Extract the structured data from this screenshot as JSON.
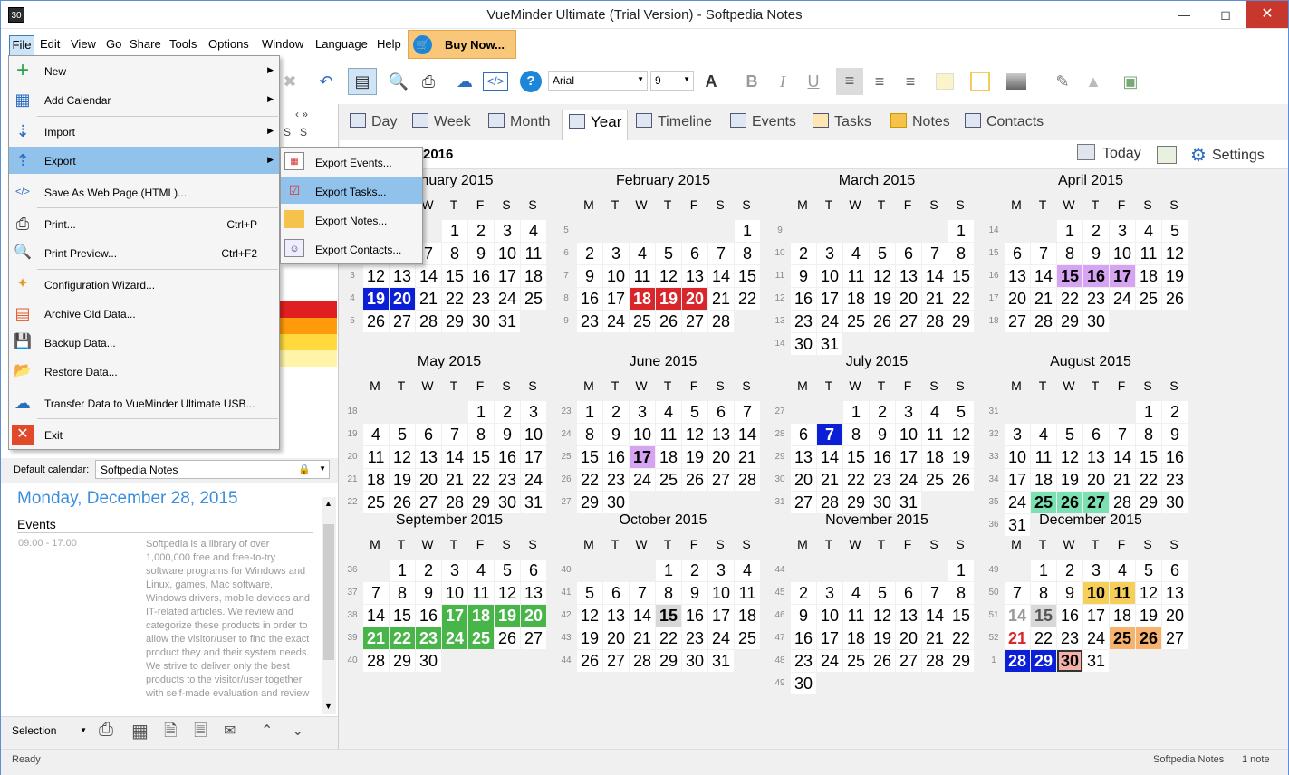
{
  "window": {
    "title": "VueMinder Ultimate (Trial Version) - Softpedia Notes",
    "icon_text": "30"
  },
  "menubar": {
    "items": [
      "File",
      "Edit",
      "View",
      "Go",
      "Share",
      "Tools",
      "Options",
      "Window",
      "Language",
      "Help"
    ],
    "buy_now": "Buy Now..."
  },
  "toolbar": {
    "font": "Arial",
    "size": "9"
  },
  "file_menu": {
    "items": [
      {
        "label": "New",
        "submenu": true
      },
      {
        "label": "Add Calendar",
        "submenu": true
      },
      {
        "label": "Import",
        "submenu": true
      },
      {
        "label": "Export",
        "submenu": true
      },
      {
        "label": "Save As Web Page (HTML)..."
      },
      {
        "label": "Print...",
        "shortcut": "Ctrl+P"
      },
      {
        "label": "Print Preview...",
        "shortcut": "Ctrl+F2"
      },
      {
        "label": "Configuration Wizard..."
      },
      {
        "label": "Archive Old Data..."
      },
      {
        "label": "Backup Data..."
      },
      {
        "label": "Restore Data..."
      },
      {
        "label": "Transfer Data to VueMinder Ultimate USB..."
      },
      {
        "label": "Exit"
      }
    ]
  },
  "export_submenu": {
    "items": [
      "Export Events...",
      "Export Tasks...",
      "Export Notes...",
      "Export Contacts..."
    ]
  },
  "view_tabs": [
    "Day",
    "Week",
    "Month",
    "Year",
    "Timeline",
    "Events",
    "Tasks",
    "Notes",
    "Contacts"
  ],
  "range_label": "2016",
  "today_label": "Today",
  "settings_label": "Settings",
  "default_calendar": {
    "label": "Default calendar:",
    "value": "Softpedia Notes"
  },
  "day_info": {
    "title": "Monday, December 28, 2015",
    "events_label": "Events",
    "event_time": "09:00 - 17:00",
    "event_description": "Softpedia is a library of over 1,000,000 free and free-to-try software programs for Windows and Linux, games, Mac software, Windows drivers, mobile devices and IT-related articles. We review and categorize these products in order to allow the visitor/user to find the exact product they and their system needs. We strive to deliver only the best products to the visitor/user together with self-made evaluation and review"
  },
  "bottom_bar": {
    "selection": "Selection"
  },
  "mini_calendar": {
    "header": [
      "S",
      "S"
    ]
  },
  "weekdays": [
    "M",
    "T",
    "W",
    "T",
    "F",
    "S",
    "S"
  ],
  "months": [
    {
      "name": "January 2015",
      "offset": 3,
      "days": 31,
      "week_start": 1
    },
    {
      "name": "February 2015",
      "offset": 6,
      "days": 28,
      "week_start": 5
    },
    {
      "name": "March 2015",
      "offset": 6,
      "days": 31,
      "week_start": 9
    },
    {
      "name": "April 2015",
      "offset": 2,
      "days": 30,
      "week_start": 14
    },
    {
      "name": "May 2015",
      "offset": 4,
      "days": 31,
      "week_start": 18
    },
    {
      "name": "June 2015",
      "offset": 0,
      "days": 30,
      "week_start": 23
    },
    {
      "name": "July 2015",
      "offset": 2,
      "days": 31,
      "week_start": 27
    },
    {
      "name": "August 2015",
      "offset": 5,
      "days": 31,
      "week_start": 31
    },
    {
      "name": "September 2015",
      "offset": 1,
      "days": 30,
      "week_start": 36
    },
    {
      "name": "October 2015",
      "offset": 3,
      "days": 31,
      "week_start": 40
    },
    {
      "name": "November 2015",
      "offset": 6,
      "days": 30,
      "week_start": 44
    },
    {
      "name": "December 2015",
      "offset": 1,
      "days": 31,
      "week_start": 49
    }
  ],
  "highlights": [
    {
      "m": 0,
      "d": [
        19,
        20
      ],
      "bg": "#0a1fd6",
      "fg": "#ffffff"
    },
    {
      "m": 1,
      "d": [
        18,
        19,
        20
      ],
      "bg": "#d9262b",
      "fg": "#ffffff"
    },
    {
      "m": 3,
      "d": [
        15,
        16,
        17
      ],
      "bg": "#d6a4f2",
      "fg": "#000000"
    },
    {
      "m": 5,
      "d": [
        17
      ],
      "bg": "#d6a4f2",
      "fg": "#000000"
    },
    {
      "m": 6,
      "d": [
        7
      ],
      "bg": "#0a1fd6",
      "fg": "#ffffff"
    },
    {
      "m": 7,
      "d": [
        25,
        26,
        27
      ],
      "bg": "#7be0b2",
      "fg": "#000000"
    },
    {
      "m": 8,
      "d": [
        17,
        18,
        19,
        20,
        21,
        22,
        23,
        24,
        25
      ],
      "bg": "#48b549",
      "fg": "#ffffff"
    },
    {
      "m": 9,
      "d": [
        15
      ],
      "bg": "#d8d8d8",
      "fg": "#000000"
    },
    {
      "m": 11,
      "d": [
        10,
        11
      ],
      "bg": "#f5cf57",
      "fg": "#000000"
    },
    {
      "m": 11,
      "d": [
        15
      ],
      "bg": "#d8d8d8",
      "fg": "#555555"
    },
    {
      "m": 11,
      "d": [
        25,
        26
      ],
      "bg": "#f7b26e",
      "fg": "#000000"
    },
    {
      "m": 11,
      "d": [
        28,
        29
      ],
      "bg": "#0a1fd6",
      "fg": "#ffffff"
    },
    {
      "m": 11,
      "d": [
        30
      ],
      "bg": "#f4b1a8",
      "fg": "#000000"
    }
  ],
  "special_text": [
    {
      "m": 11,
      "d": 14,
      "fg": "#999999"
    },
    {
      "m": 11,
      "d": 21,
      "fg": "#d9262b"
    }
  ],
  "status": {
    "left": "Ready",
    "calendar": "Softpedia Notes",
    "notes": "1 note"
  }
}
